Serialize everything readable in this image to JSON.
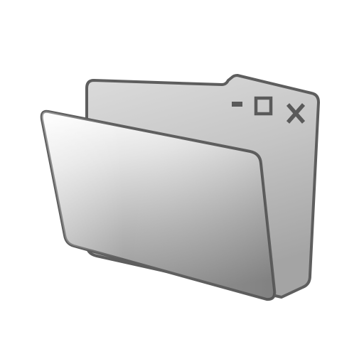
{
  "icon": {
    "name": "folder-window-icon",
    "window_controls": [
      "minimize-icon",
      "maximize-icon",
      "close-icon"
    ]
  },
  "colors": {
    "background": "#ffffff",
    "outline": "#5e5e5e",
    "back_panel_light": "#d6d6d6",
    "back_panel_dark": "#a9a9a9",
    "front_panel_light": "#f2f2f2",
    "front_panel_dark": "#8d8d8d",
    "control_glyph": "#5a5a5a"
  }
}
